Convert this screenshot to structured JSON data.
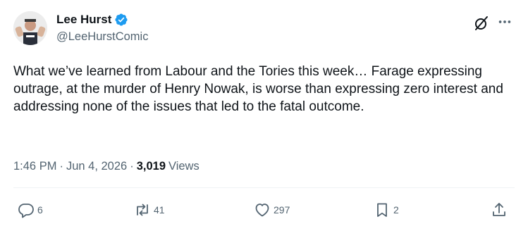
{
  "author": {
    "display_name": "Lee Hurst",
    "handle": "@LeeHurstComic",
    "verified": true,
    "verified_color": "#1d9bf0"
  },
  "tweet": {
    "text": "What we’ve learned from Labour and the Tories this week… Farage expressing outrage, at the murder of Henry Nowak, is worse than expressing zero interest and addressing none of the issues that led to the fatal outcome."
  },
  "meta": {
    "time": "1:46 PM",
    "date": "Jun 4, 2026",
    "separator": "·",
    "views_count": "3,019",
    "views_label": "Views"
  },
  "actions": {
    "replies": "6",
    "reposts": "41",
    "likes": "297",
    "bookmarks": "2"
  },
  "icons": {
    "grok": "grok-icon",
    "more": "more-icon",
    "reply": "reply-icon",
    "repost": "repost-icon",
    "like": "heart-icon",
    "bookmark": "bookmark-icon",
    "share": "share-icon"
  },
  "colors": {
    "text_primary": "#0f1419",
    "text_secondary": "#536471",
    "divider": "#eff3f4"
  }
}
